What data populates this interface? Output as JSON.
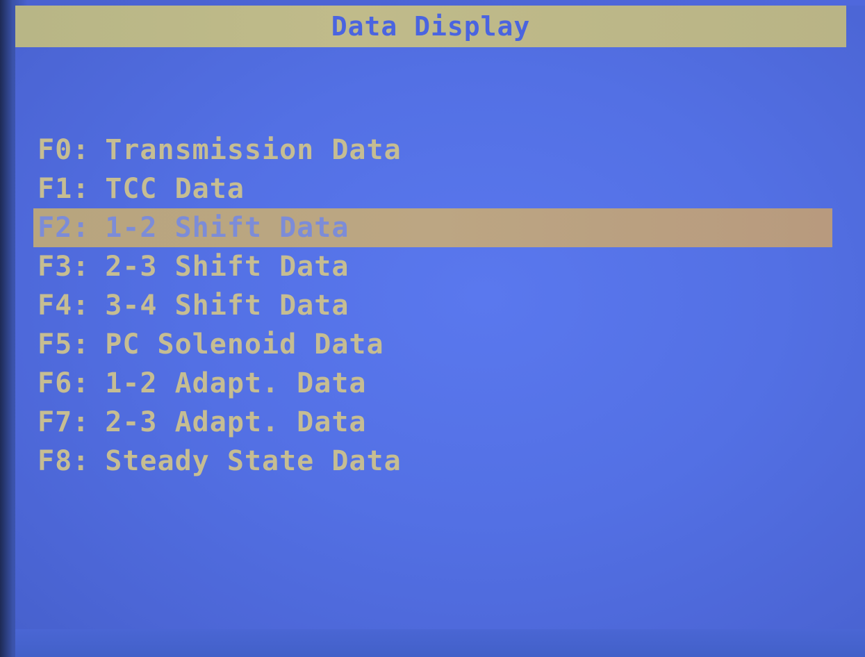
{
  "window": {
    "title": "Data Display"
  },
  "menu": {
    "selected_index": 2,
    "items": [
      {
        "key": "F0:",
        "label": "Transmission Data"
      },
      {
        "key": "F1:",
        "label": "TCC Data"
      },
      {
        "key": "F2:",
        "label": "1-2 Shift Data"
      },
      {
        "key": "F3:",
        "label": "2-3 Shift Data"
      },
      {
        "key": "F4:",
        "label": "3-4 Shift Data"
      },
      {
        "key": "F5:",
        "label": "PC Solenoid Data"
      },
      {
        "key": "F6:",
        "label": "1-2 Adapt. Data"
      },
      {
        "key": "F7:",
        "label": "2-3 Adapt. Data"
      },
      {
        "key": "F8:",
        "label": "Steady State Data"
      }
    ]
  },
  "colors": {
    "background": "#5370e4",
    "title_bar": "#c0bb8a",
    "title_text": "#4a64e0",
    "menu_text": "#c6bd92",
    "highlight": "#bca683"
  }
}
